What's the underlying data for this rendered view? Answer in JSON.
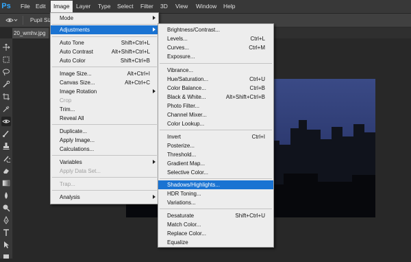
{
  "app": {
    "logo": "Ps"
  },
  "menubar": {
    "items": [
      {
        "label": "File"
      },
      {
        "label": "Edit"
      },
      {
        "label": "Image"
      },
      {
        "label": "Layer"
      },
      {
        "label": "Type"
      },
      {
        "label": "Select"
      },
      {
        "label": "Filter"
      },
      {
        "label": "3D"
      },
      {
        "label": "View"
      },
      {
        "label": "Window"
      },
      {
        "label": "Help"
      }
    ]
  },
  "options_bar": {
    "pupil_size_label": "Pupil Siz"
  },
  "document_tab": {
    "title": "20_wmhv.jpg"
  },
  "image_menu": {
    "items": [
      {
        "label": "Mode"
      },
      {
        "label": "Adjustments"
      },
      {
        "label": "Auto Tone",
        "shortcut": "Shift+Ctrl+L"
      },
      {
        "label": "Auto Contrast",
        "shortcut": "Alt+Shift+Ctrl+L"
      },
      {
        "label": "Auto Color",
        "shortcut": "Shift+Ctrl+B"
      },
      {
        "label": "Image Size...",
        "shortcut": "Alt+Ctrl+I"
      },
      {
        "label": "Canvas Size...",
        "shortcut": "Alt+Ctrl+C"
      },
      {
        "label": "Image Rotation"
      },
      {
        "label": "Crop"
      },
      {
        "label": "Trim..."
      },
      {
        "label": "Reveal All"
      },
      {
        "label": "Duplicate..."
      },
      {
        "label": "Apply Image..."
      },
      {
        "label": "Calculations..."
      },
      {
        "label": "Variables"
      },
      {
        "label": "Apply Data Set..."
      },
      {
        "label": "Trap..."
      },
      {
        "label": "Analysis"
      }
    ]
  },
  "adjustments_menu": {
    "items": [
      {
        "label": "Brightness/Contrast..."
      },
      {
        "label": "Levels...",
        "shortcut": "Ctrl+L"
      },
      {
        "label": "Curves...",
        "shortcut": "Ctrl+M"
      },
      {
        "label": "Exposure..."
      },
      {
        "label": "Vibrance..."
      },
      {
        "label": "Hue/Saturation...",
        "shortcut": "Ctrl+U"
      },
      {
        "label": "Color Balance...",
        "shortcut": "Ctrl+B"
      },
      {
        "label": "Black & White...",
        "shortcut": "Alt+Shift+Ctrl+B"
      },
      {
        "label": "Photo Filter..."
      },
      {
        "label": "Channel Mixer..."
      },
      {
        "label": "Color Lookup..."
      },
      {
        "label": "Invert",
        "shortcut": "Ctrl+I"
      },
      {
        "label": "Posterize..."
      },
      {
        "label": "Threshold..."
      },
      {
        "label": "Gradient Map..."
      },
      {
        "label": "Selective Color..."
      },
      {
        "label": "Shadows/Highlights..."
      },
      {
        "label": "HDR Toning..."
      },
      {
        "label": "Variations..."
      },
      {
        "label": "Desaturate",
        "shortcut": "Shift+Ctrl+U"
      },
      {
        "label": "Match Color..."
      },
      {
        "label": "Replace Color..."
      },
      {
        "label": "Equalize"
      }
    ]
  },
  "colors": {
    "menubar_bg": "#383838",
    "menu_bg": "#ededed",
    "highlight": "#1a73d2",
    "logo": "#31a8ff"
  }
}
